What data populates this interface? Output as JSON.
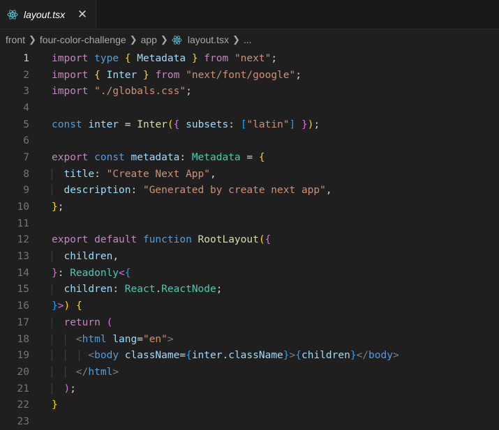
{
  "tab": {
    "filename": "layout.tsx",
    "close": "✕"
  },
  "breadcrumb": [
    "front",
    "four-color-challenge",
    "app",
    "layout.tsx",
    "..."
  ],
  "colors": {
    "react_icon": "#58c4dc",
    "keyword": "#569cd6",
    "string": "#ce9178"
  },
  "active_line": 1,
  "lines": [
    {
      "n": "1",
      "tokens": [
        [
          "import",
          "ctl"
        ],
        [
          " ",
          "pun"
        ],
        [
          "type",
          "kw"
        ],
        [
          " ",
          "pun"
        ],
        [
          "{",
          "br1"
        ],
        [
          " ",
          "pun"
        ],
        [
          "Metadata",
          "var"
        ],
        [
          " ",
          "pun"
        ],
        [
          "}",
          "br1"
        ],
        [
          " ",
          "pun"
        ],
        [
          "from",
          "ctl"
        ],
        [
          " ",
          "pun"
        ],
        [
          "\"next\"",
          "str"
        ],
        [
          ";",
          "pun"
        ]
      ]
    },
    {
      "n": "2",
      "tokens": [
        [
          "import",
          "ctl"
        ],
        [
          " ",
          "pun"
        ],
        [
          "{",
          "br1"
        ],
        [
          " ",
          "pun"
        ],
        [
          "Inter",
          "var"
        ],
        [
          " ",
          "pun"
        ],
        [
          "}",
          "br1"
        ],
        [
          " ",
          "pun"
        ],
        [
          "from",
          "ctl"
        ],
        [
          " ",
          "pun"
        ],
        [
          "\"next/font/google\"",
          "str"
        ],
        [
          ";",
          "pun"
        ]
      ]
    },
    {
      "n": "3",
      "tokens": [
        [
          "import",
          "ctl"
        ],
        [
          " ",
          "pun"
        ],
        [
          "\"./globals.css\"",
          "str"
        ],
        [
          ";",
          "pun"
        ]
      ]
    },
    {
      "n": "4",
      "tokens": []
    },
    {
      "n": "5",
      "tokens": [
        [
          "const",
          "kw"
        ],
        [
          " ",
          "pun"
        ],
        [
          "inter",
          "var"
        ],
        [
          " = ",
          "pun"
        ],
        [
          "Inter",
          "fn"
        ],
        [
          "(",
          "br1"
        ],
        [
          "{",
          "br2"
        ],
        [
          " ",
          "pun"
        ],
        [
          "subsets",
          "var"
        ],
        [
          ": ",
          "pun"
        ],
        [
          "[",
          "br3"
        ],
        [
          "\"latin\"",
          "str"
        ],
        [
          "]",
          "br3"
        ],
        [
          " ",
          "pun"
        ],
        [
          "}",
          "br2"
        ],
        [
          ")",
          "br1"
        ],
        [
          ";",
          "pun"
        ]
      ]
    },
    {
      "n": "6",
      "tokens": []
    },
    {
      "n": "7",
      "tokens": [
        [
          "export",
          "ctl"
        ],
        [
          " ",
          "pun"
        ],
        [
          "const",
          "kw"
        ],
        [
          " ",
          "pun"
        ],
        [
          "metadata",
          "var"
        ],
        [
          ": ",
          "pun"
        ],
        [
          "Metadata",
          "typ"
        ],
        [
          " = ",
          "pun"
        ],
        [
          "{",
          "br1"
        ]
      ]
    },
    {
      "n": "8",
      "indent": 1,
      "tokens": [
        [
          "title",
          "var"
        ],
        [
          ": ",
          "pun"
        ],
        [
          "\"Create Next App\"",
          "str"
        ],
        [
          ",",
          "pun"
        ]
      ]
    },
    {
      "n": "9",
      "indent": 1,
      "tokens": [
        [
          "description",
          "var"
        ],
        [
          ": ",
          "pun"
        ],
        [
          "\"Generated by create next app\"",
          "str"
        ],
        [
          ",",
          "pun"
        ]
      ]
    },
    {
      "n": "10",
      "tokens": [
        [
          "}",
          "br1"
        ],
        [
          ";",
          "pun"
        ]
      ]
    },
    {
      "n": "11",
      "tokens": []
    },
    {
      "n": "12",
      "tokens": [
        [
          "export",
          "ctl"
        ],
        [
          " ",
          "pun"
        ],
        [
          "default",
          "ctl"
        ],
        [
          " ",
          "pun"
        ],
        [
          "function",
          "kw"
        ],
        [
          " ",
          "pun"
        ],
        [
          "RootLayout",
          "fn"
        ],
        [
          "(",
          "br1"
        ],
        [
          "{",
          "br2"
        ]
      ]
    },
    {
      "n": "13",
      "indent": 1,
      "tokens": [
        [
          "children",
          "var"
        ],
        [
          ",",
          "pun"
        ]
      ]
    },
    {
      "n": "14",
      "tokens": [
        [
          "}",
          "br2"
        ],
        [
          ": ",
          "pun"
        ],
        [
          "Readonly",
          "typ"
        ],
        [
          "<",
          "br2"
        ],
        [
          "{",
          "br3"
        ]
      ]
    },
    {
      "n": "15",
      "indent": 1,
      "tokens": [
        [
          "children",
          "var"
        ],
        [
          ": ",
          "pun"
        ],
        [
          "React",
          "typ"
        ],
        [
          ".",
          "pun"
        ],
        [
          "ReactNode",
          "typ"
        ],
        [
          ";",
          "pun"
        ]
      ]
    },
    {
      "n": "16",
      "tokens": [
        [
          "}",
          "br3"
        ],
        [
          ">",
          "br2"
        ],
        [
          ")",
          "br1"
        ],
        [
          " ",
          "pun"
        ],
        [
          "{",
          "br1"
        ]
      ]
    },
    {
      "n": "17",
      "indent": 1,
      "tokens": [
        [
          "return",
          "ctl"
        ],
        [
          " ",
          "pun"
        ],
        [
          "(",
          "br2"
        ]
      ]
    },
    {
      "n": "18",
      "indent": 2,
      "tokens": [
        [
          "<",
          "tag"
        ],
        [
          "html",
          "tagn"
        ],
        [
          " ",
          "pun"
        ],
        [
          "lang",
          "var"
        ],
        [
          "=",
          "pun"
        ],
        [
          "\"en\"",
          "str"
        ],
        [
          ">",
          "tag"
        ]
      ]
    },
    {
      "n": "19",
      "indent": 3,
      "tokens": [
        [
          "<",
          "tag"
        ],
        [
          "body",
          "tagn"
        ],
        [
          " ",
          "pun"
        ],
        [
          "className",
          "var"
        ],
        [
          "=",
          "pun"
        ],
        [
          "{",
          "br3"
        ],
        [
          "inter",
          "var"
        ],
        [
          ".",
          "pun"
        ],
        [
          "className",
          "var"
        ],
        [
          "}",
          "br3"
        ],
        [
          ">",
          "tag"
        ],
        [
          "{",
          "br3"
        ],
        [
          "children",
          "var"
        ],
        [
          "}",
          "br3"
        ],
        [
          "</",
          "tag"
        ],
        [
          "body",
          "tagn"
        ],
        [
          ">",
          "tag"
        ]
      ]
    },
    {
      "n": "20",
      "indent": 2,
      "tokens": [
        [
          "</",
          "tag"
        ],
        [
          "html",
          "tagn"
        ],
        [
          ">",
          "tag"
        ]
      ]
    },
    {
      "n": "21",
      "indent": 1,
      "tokens": [
        [
          ")",
          "br2"
        ],
        [
          ";",
          "pun"
        ]
      ]
    },
    {
      "n": "22",
      "tokens": [
        [
          "}",
          "br1"
        ]
      ]
    },
    {
      "n": "23",
      "tokens": []
    }
  ]
}
